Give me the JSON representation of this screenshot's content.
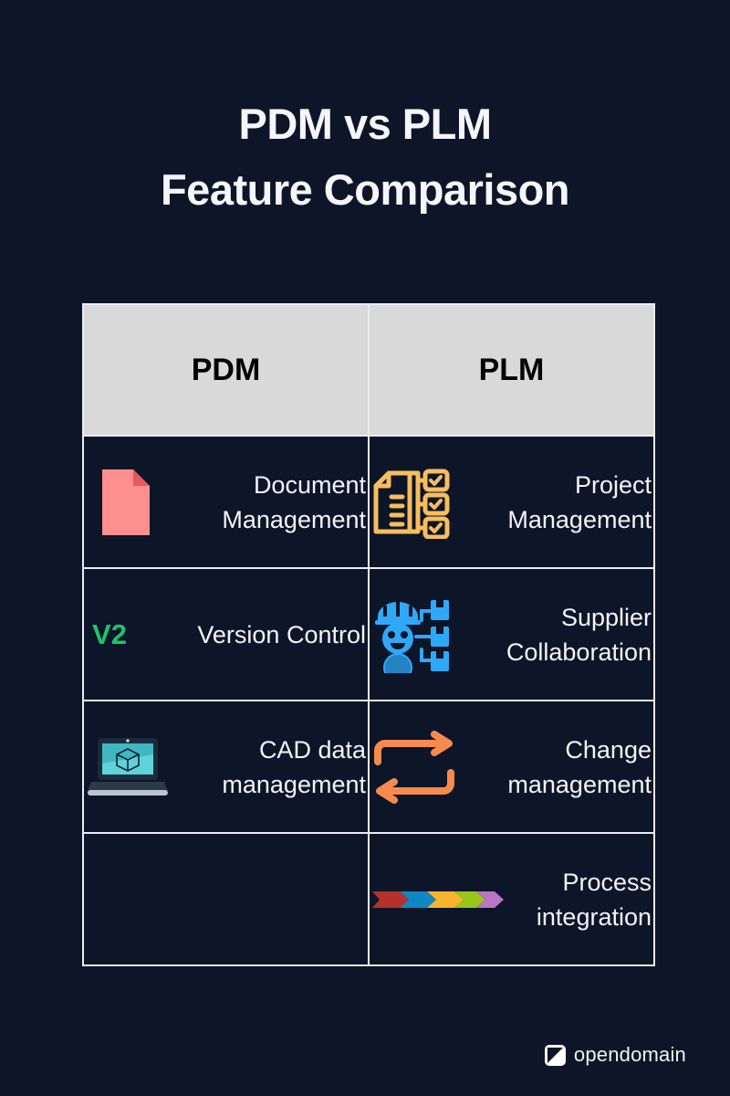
{
  "page": {
    "background_color": "#0d1529",
    "title_lines": [
      "PDM vs PLM",
      "Feature Comparison"
    ]
  },
  "table": {
    "header_background": "#d9d9d9",
    "border_color": "#e9ecf2",
    "columns": [
      {
        "label": "PDM"
      },
      {
        "label": "PLM"
      }
    ],
    "rows": [
      {
        "pdm": {
          "icon": "document-page-icon",
          "icon_color": "#fd8f8f",
          "label": "Document\nManagement"
        },
        "plm": {
          "icon": "project-checklist-icon",
          "icon_color": "#f7bd5e",
          "label": "Project\nManagement"
        }
      },
      {
        "pdm": {
          "icon": "version-v2-badge-icon",
          "icon_color": "#1fc36b",
          "badge_text": "V2",
          "label": "Version Control"
        },
        "plm": {
          "icon": "supplier-worker-network-icon",
          "icon_color": "#2fa9f7",
          "label": "Supplier\nCollaboration"
        }
      },
      {
        "pdm": {
          "icon": "laptop-cad-cube-icon",
          "icon_color": "#3fb8c4",
          "label": "CAD data\nmanagement"
        },
        "plm": {
          "icon": "exchange-arrows-icon",
          "icon_color": "#f58b4c",
          "label": "Change\nmanagement"
        }
      },
      {
        "pdm": {
          "icon": "",
          "label": ""
        },
        "plm": {
          "icon": "process-chevrons-icon",
          "label": "Process\nintegration",
          "chevron_colors": [
            "#b5322c",
            "#0f87c4",
            "#f9b42d",
            "#9ac617",
            "#b濃"
          ]
        }
      }
    ]
  },
  "footer": {
    "brand": "opendomain",
    "logo_icon": "opendomain-logo-icon"
  }
}
